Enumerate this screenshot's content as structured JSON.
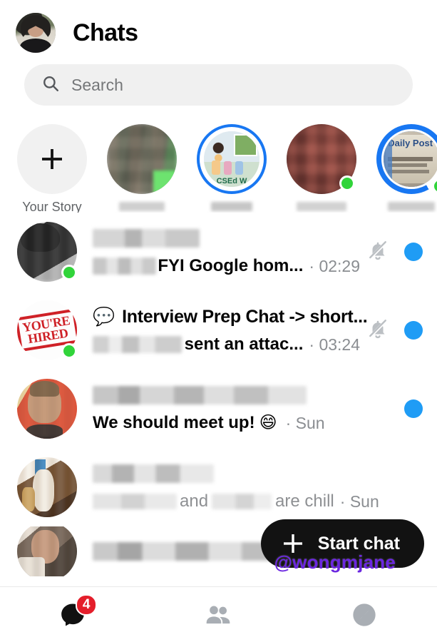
{
  "header": {
    "title": "Chats",
    "avatar_name": "profile-avatar"
  },
  "search": {
    "placeholder": "Search",
    "value": "",
    "icon": "search-icon"
  },
  "stories": {
    "add_story_label": "Your Story",
    "add_story_icon": "plus-icon",
    "items": [
      {
        "label": "",
        "ring": "none",
        "online": false,
        "caption_redacted": true
      },
      {
        "label": "CSEd W",
        "ring": "full",
        "online": false,
        "caption_redacted": true
      },
      {
        "label": "",
        "ring": "none",
        "online": true,
        "caption_redacted": true
      },
      {
        "label": "Daily Post",
        "ring": "partial",
        "online": true,
        "caption_redacted": true
      },
      {
        "label": "",
        "ring": "none",
        "online": false,
        "caption_redacted": true
      }
    ]
  },
  "chats": [
    {
      "name_redacted": true,
      "title": "",
      "snippet": "FYI Google hom...",
      "snippet_prefix_redacted": true,
      "time": "02:29",
      "unread": true,
      "muted": true,
      "online": true,
      "read": false,
      "emoji": "",
      "avatar_kind": "photo-bw"
    },
    {
      "name_redacted": false,
      "title": "Interview Prep Chat -> short...",
      "snippet": "sent an attac...",
      "snippet_prefix_redacted": true,
      "time": "03:24",
      "unread": true,
      "muted": true,
      "online": true,
      "read": false,
      "emoji": "💬",
      "avatar_kind": "youre-hired-stamp"
    },
    {
      "name_redacted": true,
      "title": "",
      "snippet": "We should meet up!",
      "snippet_prefix_redacted": false,
      "time": "Sun",
      "unread": true,
      "muted": false,
      "online": false,
      "read": false,
      "emoji": "😄",
      "emoji_position": "after-snippet",
      "avatar_kind": "photo-red"
    },
    {
      "name_redacted": true,
      "title": "",
      "snippet": "and",
      "snippet_suffix": "are chill",
      "snippet_prefix_redacted": true,
      "time": "Sun",
      "unread": false,
      "muted": false,
      "online": false,
      "read": true,
      "emoji": "",
      "avatar_kind": "photo-warm"
    },
    {
      "name_redacted": true,
      "title": "",
      "snippet": "",
      "time": "",
      "unread": false,
      "muted": false,
      "online": false,
      "read": true,
      "emoji": "",
      "avatar_kind": "photo-person"
    }
  ],
  "fab": {
    "label": "Start chat",
    "icon": "plus-icon"
  },
  "watermark": {
    "text": "@wongmjane"
  },
  "bottom_nav": {
    "items": [
      {
        "name": "chats",
        "icon": "chat-bubble-icon",
        "active": true,
        "badge": "4"
      },
      {
        "name": "people",
        "icon": "people-icon",
        "active": false,
        "badge": ""
      },
      {
        "name": "discover",
        "icon": "compass-icon",
        "active": false,
        "badge": ""
      }
    ]
  },
  "colors": {
    "accent_blue": "#1877f2",
    "unread_dot": "#1f9cf5",
    "online_green": "#31d43a",
    "badge_red": "#e41e2b",
    "fab_bg": "#121212",
    "watermark_purple": "#6b27e0"
  }
}
